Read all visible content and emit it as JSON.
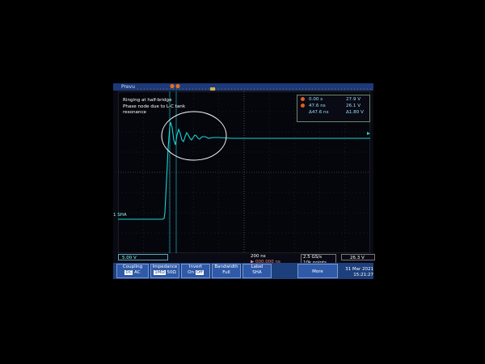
{
  "app": {
    "mode_label": "Prevu"
  },
  "annotation": {
    "line1": "Ringing at half-bridge",
    "line2": "Phase node due to L-C tank",
    "line3": "resonance"
  },
  "cursors": {
    "rows": [
      {
        "key": "a",
        "time": "0.00 s",
        "volt": "27.9 V"
      },
      {
        "key": "b",
        "time": "47.6 ns",
        "volt": "26.1 V"
      },
      {
        "key": "Δ",
        "time": "Δ47.6 ns",
        "volt": "Δ1.80 V"
      }
    ]
  },
  "status": {
    "ch1_scale": "5.00 V",
    "ch_label": "1 SHA",
    "timebase": "200 ns",
    "trigger_pos": "▶ 000.000 ns",
    "sample_rate": "2.5 GS/s",
    "record_length": "10k points",
    "trigger_level": "26.3 V"
  },
  "menu": {
    "coupling": {
      "label": "Coupling",
      "opt1": "DC",
      "opt2": "AC"
    },
    "impedance": {
      "label": "Impedance",
      "opt1": "1MΩ",
      "opt2": "50Ω"
    },
    "invert": {
      "label": "Invert",
      "opt1": "On",
      "opt2": "Off"
    },
    "bandwidth": {
      "label": "Bandwidth",
      "value": "Full"
    },
    "label_btn": {
      "label": "Label",
      "value": "SHA"
    },
    "more": {
      "label": "More"
    }
  },
  "datetime": {
    "date": "31 Mar 2021",
    "time": "15:21:27"
  },
  "colors": {
    "trace": "#19d6d6",
    "menu_bg": "#1d3f7c",
    "button_bg": "#2f5aa8"
  }
}
